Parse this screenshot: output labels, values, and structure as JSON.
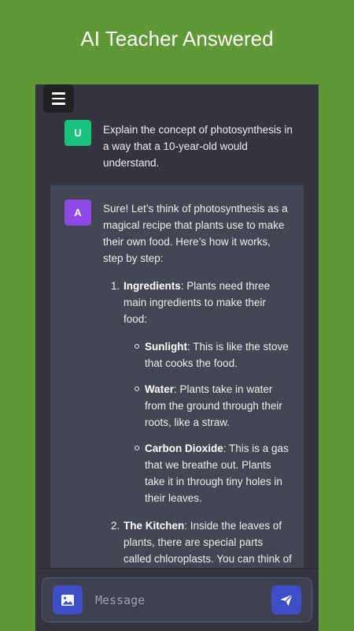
{
  "banner": {
    "title": "AI Teacher Answered"
  },
  "chat": {
    "user": {
      "avatar_letter": "U",
      "text": "Explain the concept of photosynthesis in a way that a 10-year-old would understand."
    },
    "assistant": {
      "avatar_letter": "A",
      "intro": "Sure! Let’s think of photosynthesis as a magical recipe that plants use to make their own food. Here’s how it works, step by step:",
      "steps": [
        {
          "number": "1.",
          "title": "Ingredients",
          "text": ": Plants need three main ingredients to make their food:",
          "items": [
            {
              "title": "Sunlight",
              "text": ": This is like the stove that cooks the food."
            },
            {
              "title": "Water",
              "text": ": Plants take in water from the ground through their roots, like a straw."
            },
            {
              "title": "Carbon Dioxide",
              "text": ": This is a gas that we breathe out. Plants take it in through tiny holes in their leaves."
            }
          ]
        },
        {
          "number": "2.",
          "title": "The Kitchen",
          "text": ": Inside the leaves of plants, there are special parts called chloroplasts. You can think of chloroplasts as the kitchen where all the cooking happens. They"
        }
      ]
    }
  },
  "composer": {
    "placeholder": "Message",
    "image_icon": "image-icon",
    "send_icon": "send-icon"
  },
  "colors": {
    "background": "#5f9834",
    "chat_bg": "#343541",
    "assistant_bg": "#444654",
    "user_avatar": "#19c37d",
    "assistant_avatar": "#8e49e8",
    "accent": "#3d4fc8"
  }
}
